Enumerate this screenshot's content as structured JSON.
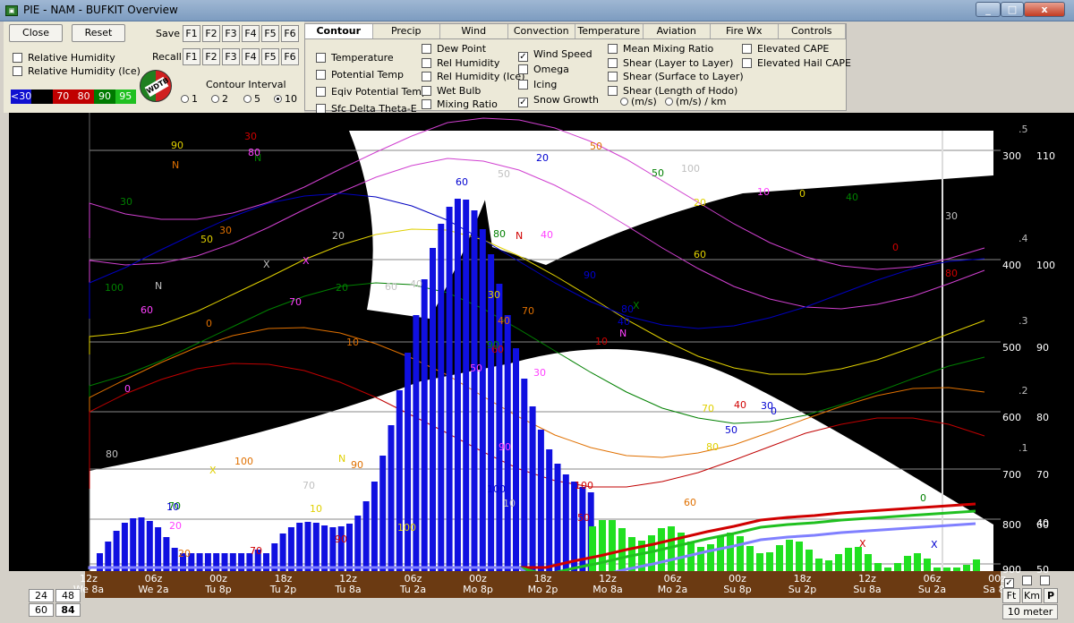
{
  "window": {
    "title": "PIE - NAM - BUFKIT Overview",
    "min": "_",
    "max": "□",
    "close": "x"
  },
  "controls": {
    "close": "Close",
    "reset": "Reset",
    "save": "Save",
    "recall": "Recall",
    "fkeys": [
      "F1",
      "F2",
      "F3",
      "F4",
      "F5",
      "F6"
    ],
    "rh": "Relative Humidity",
    "rh_ice": "Relative Humidity (Ice)",
    "contour_interval": "Contour Interval",
    "intervals": [
      "1",
      "2",
      "5",
      "10"
    ],
    "legend": [
      {
        "label": "<30",
        "color": "#1010d0"
      },
      {
        "label": "",
        "color": "#000000"
      },
      {
        "label": "70",
        "color": "#c00000"
      },
      {
        "label": "80",
        "color": "#c00000"
      },
      {
        "label": "90",
        "color": "#007a00"
      },
      {
        "label": "95",
        "color": "#20c020"
      }
    ],
    "logo": "WDTB"
  },
  "tabs": [
    "Contour",
    "Precip",
    "Wind",
    "Convection",
    "Temperature",
    "Aviation",
    "Fire Wx",
    "Controls"
  ],
  "contour": {
    "col1": [
      "Temperature",
      "Potential Temp",
      "Eqiv Potential Temp",
      "Sfc Delta Theta-E"
    ],
    "col2": [
      "Dew Point",
      "Rel Humidity",
      "Rel Humidity (Ice)",
      "Wet Bulb",
      "Mixing Ratio"
    ],
    "col3": [
      "Wind Speed",
      "Omega",
      "Icing",
      "Snow Growth"
    ],
    "col4": [
      "Mean Mixing Ratio",
      "Shear (Layer to Layer)",
      "Shear (Surface to Layer)",
      "Shear (Length of Hodo)"
    ],
    "shear_units": [
      "(m/s)",
      "(m/s) / km"
    ],
    "col5": [
      "Elevated CAPE",
      "Elevated Hail CAPE"
    ]
  },
  "right_axis": [
    {
      "p": "300",
      "ht": "110",
      "frac": ".5"
    },
    {
      "p": "400",
      "ht": "100",
      "frac": ".4"
    },
    {
      "p": "500",
      "ht": "90",
      "frac": ".3"
    },
    {
      "p": "600",
      "ht": "80",
      "frac": ".2"
    },
    {
      "p": "700",
      "ht": "70",
      "frac": ".1"
    },
    {
      "p": "800",
      "ht": "60",
      "frac": ""
    },
    {
      "p": "900",
      "ht": "50",
      "frac": ""
    }
  ],
  "right_extra": [
    "40"
  ],
  "x_ticks": [
    {
      "z": "12z",
      "d": "We 8a"
    },
    {
      "z": "06z",
      "d": "We 2a"
    },
    {
      "z": "00z",
      "d": "Tu 8p"
    },
    {
      "z": "18z",
      "d": "Tu 2p"
    },
    {
      "z": "12z",
      "d": "Tu 8a"
    },
    {
      "z": "06z",
      "d": "Tu 2a"
    },
    {
      "z": "00z",
      "d": "Mo 8p"
    },
    {
      "z": "18z",
      "d": "Mo 2p"
    },
    {
      "z": "12z",
      "d": "Mo 8a"
    },
    {
      "z": "06z",
      "d": "Mo 2a"
    },
    {
      "z": "00z",
      "d": "Su 8p"
    },
    {
      "z": "18z",
      "d": "Su 2p"
    },
    {
      "z": "12z",
      "d": "Su 8a"
    },
    {
      "z": "06z",
      "d": "Su 2a"
    },
    {
      "z": "00z",
      "d": "Sa 8p"
    }
  ],
  "bottom_left": [
    "24",
    "48",
    "60",
    "84"
  ],
  "units": {
    "ft": "Ft",
    "km": "Km",
    "p": "P",
    "level": "10 meter"
  },
  "contour_labels": [
    "30",
    "50",
    "60",
    "70",
    "80",
    "90",
    "100",
    "40",
    "20",
    "10",
    "N",
    "X",
    "0"
  ]
}
